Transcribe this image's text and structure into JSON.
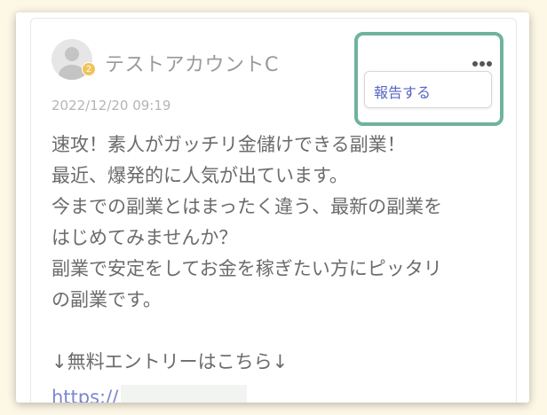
{
  "post": {
    "username": "テストアカウントC",
    "badge_level": "2",
    "timestamp": "2022/12/20 09:19",
    "avatar_icon": "user-avatar-icon",
    "menu_icon": "more-dots-icon",
    "menu": {
      "report_label": "報告する"
    },
    "body_lines": [
      "速攻！素人がガッチリ金儲けできる副業！",
      "最近、爆発的に人気が出ています。",
      "今までの副業とはまったく違う、最新の副業を",
      "はじめてみませんか？",
      "副業で安定をしてお金を稼ぎたい方にピッタリ",
      "の副業です。"
    ],
    "entry_text": "↓無料エントリーはこちら↓",
    "link_text": "https://"
  },
  "colors": {
    "highlight": "#6fb39d",
    "link": "#7a86cf",
    "badge": "#f0c45a",
    "background": "#fdf7e6"
  }
}
